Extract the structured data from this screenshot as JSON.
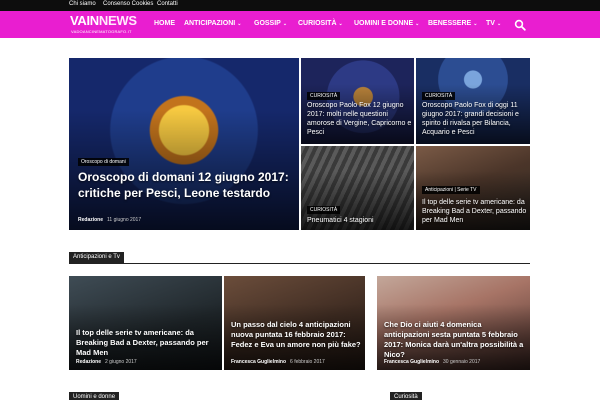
{
  "topbar": {
    "links": [
      "Chi siamo",
      "Consenso Cookies",
      "Contatti"
    ]
  },
  "logo": {
    "main1": "VAIN",
    "main2": "NEWS",
    "tagline": "VADOANCINEMATOGRAFO.IT"
  },
  "nav": {
    "items": [
      {
        "label": "HOME",
        "dropdown": false
      },
      {
        "label": "ANTICIPAZIONI",
        "dropdown": true
      },
      {
        "label": "GOSSIP",
        "dropdown": true
      },
      {
        "label": "CURIOSITÀ",
        "dropdown": true
      },
      {
        "label": "UOMINI E DONNE",
        "dropdown": true
      },
      {
        "label": "BENESSERE",
        "dropdown": true
      },
      {
        "label": "TV",
        "dropdown": true
      }
    ],
    "search_icon": "search-icon"
  },
  "featured": {
    "main": {
      "category": "Oroscopo di domani",
      "title": "Oroscopo di domani 12 giugno 2017: critiche per Pesci, Leone testardo",
      "author": "Redazione",
      "date": "11 giugno 2017"
    },
    "top_middle": {
      "category": "CURIOSITÀ",
      "title": "Oroscopo Paolo Fox 12 giugno 2017: molti nelle questioni amorose di Vergine, Capricorno e Pesci"
    },
    "top_right": {
      "category": "CURIOSITÀ",
      "title": "Oroscopo Paolo Fox di oggi 11 giugno 2017: grandi decisioni e spirito di rivalsa per Bilancia, Acquario e Pesci"
    },
    "bottom_middle": {
      "category": "CURIOSITÀ",
      "title": "Pneumatici 4 stagioni"
    },
    "bottom_right": {
      "category": "Anticipazioni | Serie TV",
      "title": "Il top delle serie tv americane: da Breaking Bad a Dexter, passando per Mad Men"
    }
  },
  "section_anticipazioni": {
    "heading": "Anticipazioni e Tv",
    "articles": [
      {
        "title": "Il top delle serie tv americane: da Breaking Bad a Dexter, passando per Mad Men",
        "author": "Redazione",
        "date": "2 giugno 2017"
      },
      {
        "title": "Un passo dal cielo 4 anticipazioni nuova puntata 16 febbraio 2017: Fedez e Eva un amore non più fake?",
        "author": "Francesca Guglielmino",
        "date": "6 febbraio 2017"
      },
      {
        "title": "Che Dio ci aiuti 4 domenica anticipazioni sesta puntata 5 febbraio 2017: Monica darà un'altra possibilità a Nico?",
        "author": "Francesca Guglielmino",
        "date": "30 gennaio 2017"
      }
    ]
  },
  "section_uomini": {
    "heading": "Uomini e donne"
  },
  "section_curiosita": {
    "heading": "Curiosità"
  },
  "colors": {
    "brand": "#e91ed0",
    "topbar": "#0d0d0d",
    "category_bg": "#000000"
  }
}
